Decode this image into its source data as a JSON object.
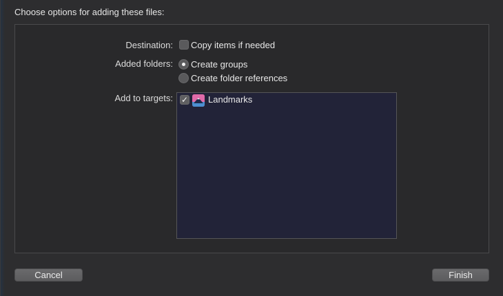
{
  "dialog": {
    "title": "Choose options for adding these files:"
  },
  "destination": {
    "label": "Destination:",
    "checkbox_label": "Copy items if needed",
    "checked": false
  },
  "added_folders": {
    "label": "Added folders:",
    "options": [
      {
        "label": "Create groups",
        "selected": true
      },
      {
        "label": "Create folder references",
        "selected": false
      }
    ]
  },
  "targets": {
    "label": "Add to targets:",
    "items": [
      {
        "name": "Landmarks",
        "checked": true,
        "icon": "landmarks-app-icon"
      }
    ]
  },
  "buttons": {
    "cancel": "Cancel",
    "finish": "Finish"
  }
}
